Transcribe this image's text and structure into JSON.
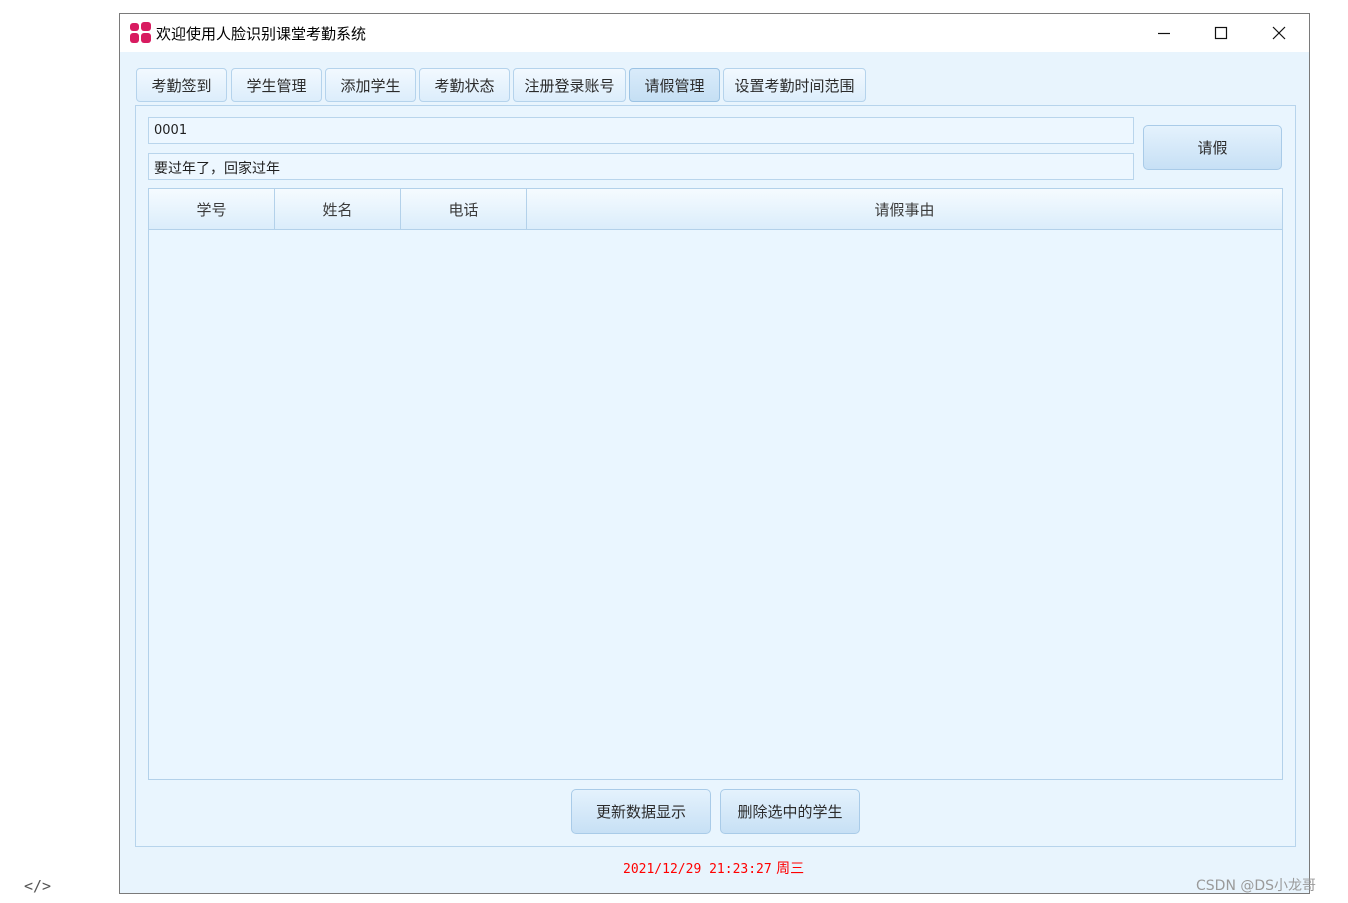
{
  "window": {
    "title": "欢迎使用人脸识别课堂考勤系统",
    "icon": "app-logo-icon",
    "controls": [
      "minimize-icon",
      "maximize-icon",
      "close-icon"
    ]
  },
  "tabs": [
    {
      "label": "考勤签到"
    },
    {
      "label": "学生管理"
    },
    {
      "label": "添加学生"
    },
    {
      "label": "考勤状态"
    },
    {
      "label": "注册登录账号"
    },
    {
      "label": "请假管理",
      "active": true
    },
    {
      "label": "设置考勤时间范围"
    }
  ],
  "form": {
    "student_id": "0001",
    "reason": "要过年了，回家过年",
    "leave_button": "请假"
  },
  "table": {
    "columns": [
      "学号",
      "姓名",
      "电话",
      "请假事由"
    ],
    "rows": []
  },
  "actions": {
    "refresh_button": "更新数据显示",
    "delete_button": "删除选中的学生"
  },
  "status": {
    "datetime": "2021/12/29 21:23:27",
    "weekday": "周三"
  },
  "page": {
    "edge_code": "</>",
    "watermark": "CSDN @DS小龙哥"
  },
  "colors": {
    "accent_logo": "#d81b60",
    "status_text": "#ff0000",
    "panel_bg": "#e9f5fe"
  }
}
